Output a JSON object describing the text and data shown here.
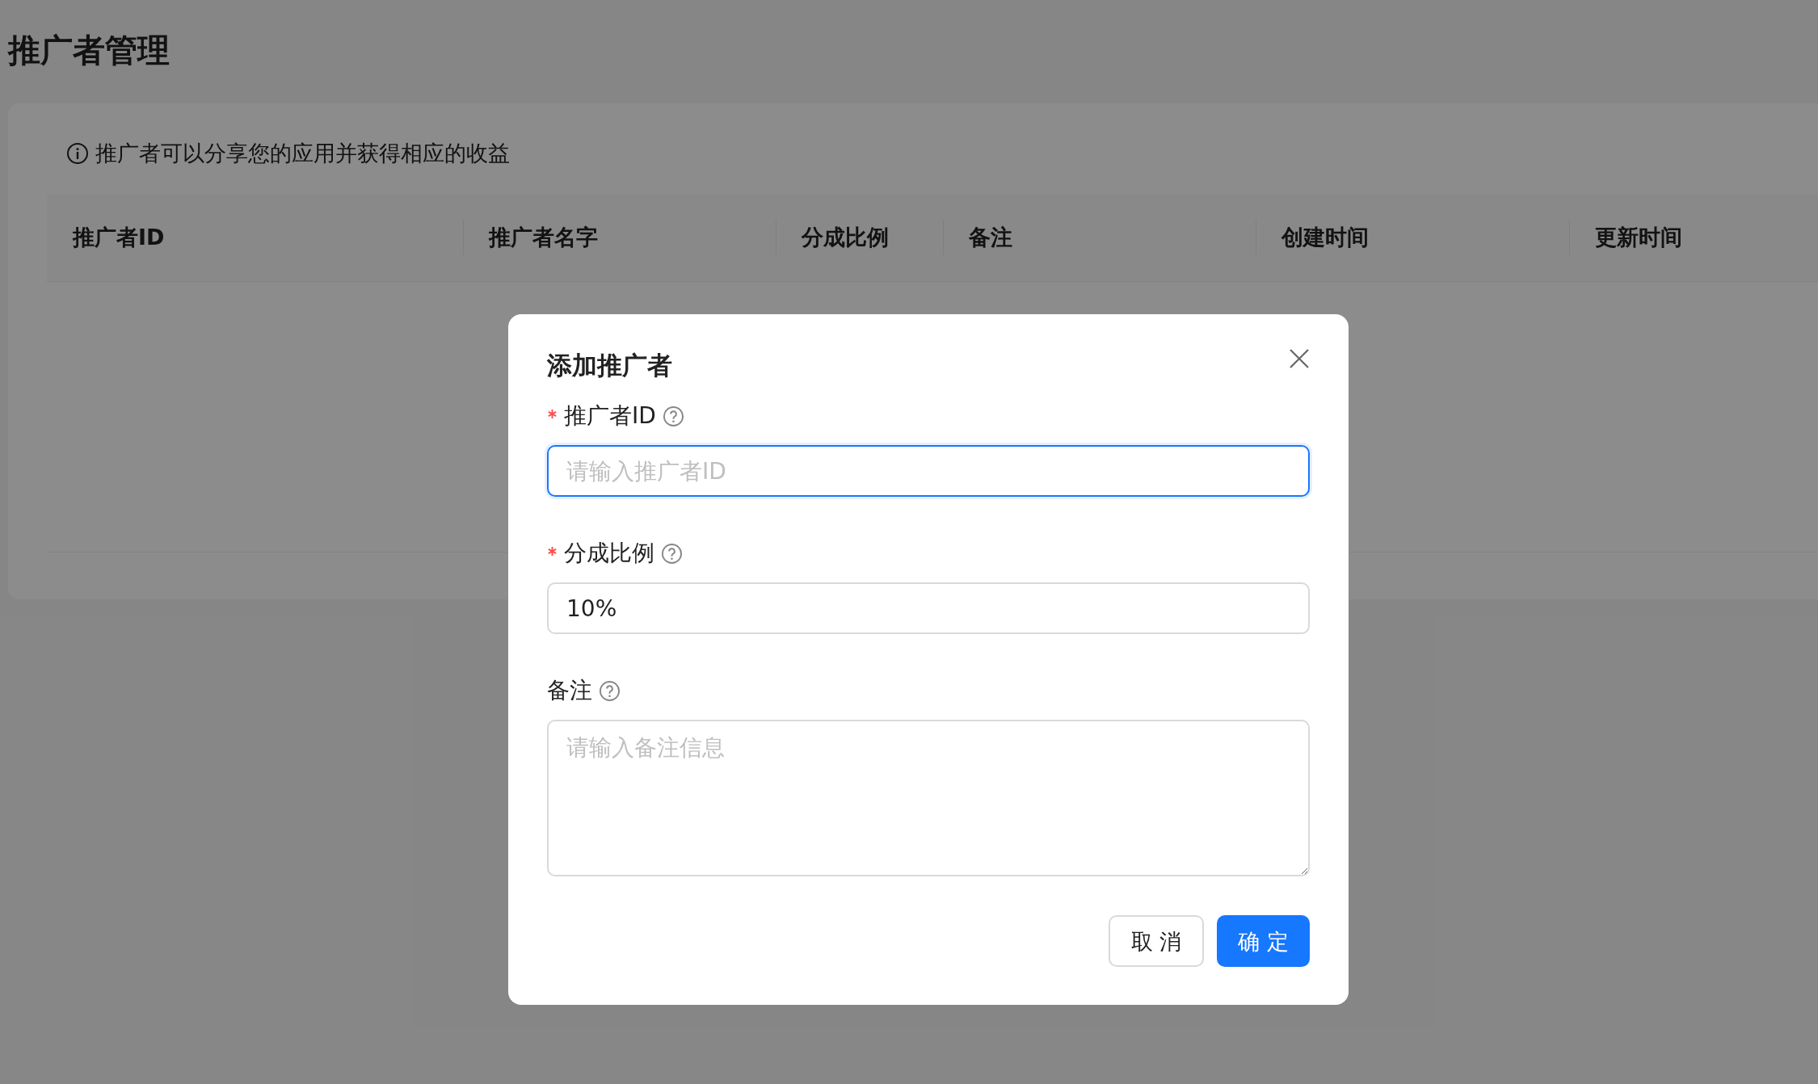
{
  "page": {
    "title": "推广者管理"
  },
  "notice": "推广者可以分享您的应用并获得相应的收益",
  "table": {
    "columns": [
      "推广者ID",
      "推广者名字",
      "分成比例",
      "备注",
      "创建时间",
      "更新时间"
    ]
  },
  "dialog": {
    "title": "添加推广者",
    "fields": [
      {
        "kind": "input",
        "label": "推广者ID",
        "required": true,
        "focused": true,
        "placeholder": "请输入推广者ID"
      },
      {
        "kind": "input",
        "label": "分成比例",
        "required": true,
        "focused": false,
        "value": "10%"
      },
      {
        "kind": "textarea",
        "label": "备注",
        "required": false,
        "focused": false,
        "placeholder": "请输入备注信息"
      }
    ],
    "buttons": [
      {
        "label": "取 消",
        "kind": "default"
      },
      {
        "label": "确 定",
        "kind": "primary"
      }
    ]
  }
}
